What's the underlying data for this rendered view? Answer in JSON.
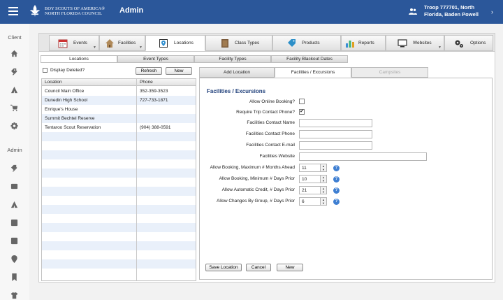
{
  "header": {
    "org_line1": "BOY SCOUTS OF AMERICA®",
    "org_line2": "NORTH FLORIDA COUNCIL",
    "app_title": "Admin",
    "user_line1": "Troop 777701, North",
    "user_line2": "Florida, Baden Powell"
  },
  "sidebar": {
    "client_label": "Client",
    "admin_label": "Admin"
  },
  "main_tabs": [
    {
      "label": "Events",
      "icon": "calendar-icon"
    },
    {
      "label": "Facilities",
      "icon": "house-icon"
    },
    {
      "label": "Locations",
      "icon": "map-icon"
    },
    {
      "label": "Class Types",
      "icon": "book-icon"
    },
    {
      "label": "Products",
      "icon": "tag-icon"
    },
    {
      "label": "Reports",
      "icon": "bar-chart-icon"
    },
    {
      "label": "Websites",
      "icon": "monitor-icon"
    },
    {
      "label": "Options",
      "icon": "gears-icon"
    }
  ],
  "sub_tabs": [
    "Locations",
    "Event Types",
    "Facility Types",
    "Facility Blackout Dates"
  ],
  "left": {
    "display_deleted_label": "Display Deleted?",
    "refresh_label": "Refresh",
    "new_label": "New",
    "columns": [
      "Location",
      "Phone"
    ],
    "rows": [
      {
        "location": "Council Main Office",
        "phone": "352-359-3523"
      },
      {
        "location": "Dunedin High School",
        "phone": "727-733-1871"
      },
      {
        "location": "Enrique's House",
        "phone": ""
      },
      {
        "location": "Summit Bechtel Reserve",
        "phone": ""
      },
      {
        "location": "Tentaroo Scout Reservation",
        "phone": "(904) 388-0591"
      }
    ]
  },
  "right": {
    "tabs": [
      "Add Location",
      "Facilities / Excursions",
      "Campsites"
    ],
    "section_title": "Facilities / Excursions",
    "fields": {
      "allow_online_booking": "Allow Online Booking?",
      "require_trip_contact": "Require Trip Contact Phone?",
      "contact_name": "Facilities Contact Name",
      "contact_phone": "Facilities Contact Phone",
      "contact_email": "Facilities Contact E-mail",
      "website": "Facilities Website",
      "max_months": "Allow Booking, Maximum # Months Ahead",
      "min_days": "Allow Booking, Minimum # Days Prior",
      "auto_credit": "Allow Automatic Credit, # Days Prior",
      "changes_by_group": "Allow Changes By Group, # Days Prior"
    },
    "values": {
      "allow_online_booking": false,
      "require_trip_contact": true,
      "max_months": "11",
      "min_days": "10",
      "auto_credit": "21",
      "changes_by_group": "6"
    },
    "buttons": {
      "save": "Save Location",
      "cancel": "Cancel",
      "new": "New"
    }
  },
  "colors": {
    "header_bg": "#2b579a",
    "help_icon": "#3f7fd2",
    "section_title": "#1f3f7a",
    "row_alt": "#e9f0fa"
  }
}
